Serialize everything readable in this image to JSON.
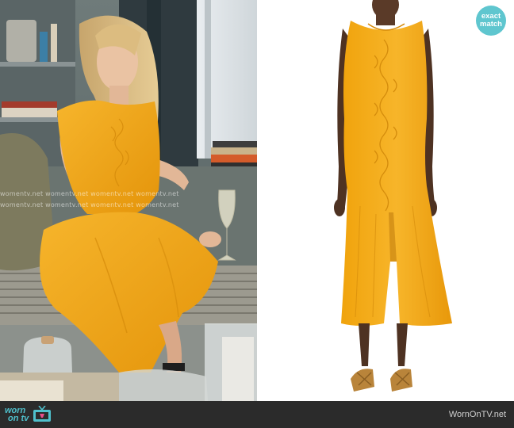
{
  "badge": {
    "line1": "exact",
    "line2": "match"
  },
  "watermark": {
    "row1": "womentv.net  womentv.net  womentv.net  womentv.net",
    "row2": "womentv.net  womentv.net  womentv.net  womentv.net"
  },
  "footer": {
    "logo_line1": "worn",
    "logo_line2": "on tv",
    "site": "WornOnTV.net"
  },
  "colors": {
    "dress": "#f3aa12",
    "badge": "#5fc6cf",
    "footer_bg": "#2b2b2b",
    "logo": "#4fc0cc"
  }
}
